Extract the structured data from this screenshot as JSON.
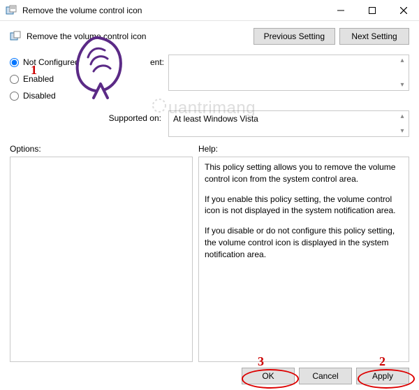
{
  "window": {
    "title": "Remove the volume control icon"
  },
  "header": {
    "policy_title": "Remove the volume control icon",
    "prev_btn": "Previous Setting",
    "next_btn": "Next Setting"
  },
  "state": {
    "not_configured": "Not Configured",
    "enabled": "Enabled",
    "disabled": "Disabled",
    "selected": "not_configured"
  },
  "labels": {
    "comment": "ent:",
    "supported_on": "Supported on:",
    "options": "Options:",
    "help": "Help:"
  },
  "supported_text": "At least Windows Vista",
  "help_paragraphs": [
    "This policy setting allows you to remove the volume control icon from the system control area.",
    "If you enable this policy setting, the volume control icon is not displayed in the system notification area.",
    "If you disable or do not configure this policy setting, the volume control icon is displayed in the system notification area."
  ],
  "footer": {
    "ok": "OK",
    "cancel": "Cancel",
    "apply": "Apply"
  },
  "annotations": {
    "one": "1",
    "two": "2",
    "three": "3"
  },
  "watermark": "uantrimang"
}
